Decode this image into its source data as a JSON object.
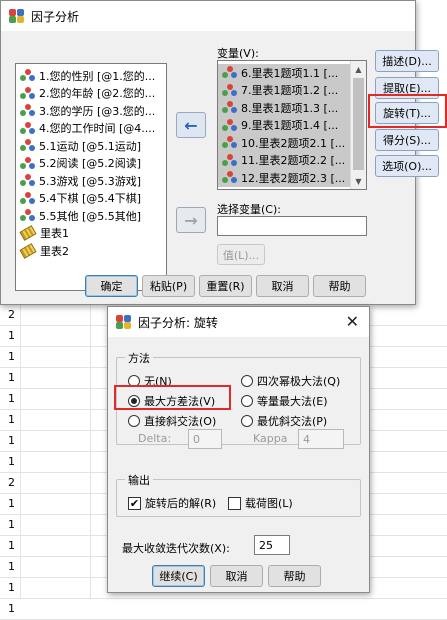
{
  "background_sheet": {
    "row_values": [
      "2",
      "1",
      "1",
      "1",
      "1",
      "1",
      "1",
      "1",
      "2",
      "1",
      "1",
      "1",
      "1",
      "1",
      "1"
    ]
  },
  "main_dialog": {
    "title": "因子分析",
    "source_variables": [
      {
        "label": "1.您的性别 [@1.您的...",
        "icon": "nominal-variable-icon"
      },
      {
        "label": "2.您的年龄 [@2.您的...",
        "icon": "nominal-variable-icon"
      },
      {
        "label": "3.您的学历 [@3.您的...",
        "icon": "nominal-variable-icon"
      },
      {
        "label": "4.您的工作时间 [@4....",
        "icon": "nominal-variable-icon"
      },
      {
        "label": "5.1运动 [@5.1运动]",
        "icon": "nominal-variable-icon"
      },
      {
        "label": "5.2阅读 [@5.2阅读]",
        "icon": "nominal-variable-icon"
      },
      {
        "label": "5.3游戏 [@5.3游戏]",
        "icon": "nominal-variable-icon"
      },
      {
        "label": "5.4下棋 [@5.4下棋]",
        "icon": "nominal-variable-icon"
      },
      {
        "label": "5.5其他 [@5.5其他]",
        "icon": "nominal-variable-icon"
      },
      {
        "label": "里表1",
        "icon": "scale-ruler-icon"
      },
      {
        "label": "里表2",
        "icon": "scale-ruler-icon"
      }
    ],
    "variables_label": "变量(V):",
    "selected_variables": [
      "6.里表1题项1.1 [...",
      "7.里表1题项1.2 [...",
      "8.里表1题项1.3 [...",
      "9.里表1题项1.4 [...",
      "10.里表2题项2.1 [...",
      "11.里表2题项2.2 [...",
      "12.里表2题项2.3 [..."
    ],
    "selection_variable_label": "选择变量(C):",
    "selection_variable_value": "",
    "value_button": "值(L)...",
    "side_buttons": [
      "描述(D)...",
      "提取(E)...",
      "旋转(T)...",
      "得分(S)...",
      "选项(O)..."
    ],
    "bottom_buttons": [
      "确定",
      "粘贴(P)",
      "重置(R)",
      "取消",
      "帮助"
    ],
    "highlighted_button": "旋转(T)..."
  },
  "rotation_dialog": {
    "title": "因子分析: 旋转",
    "method_group_label": "方法",
    "methods": [
      {
        "label": "无(N)",
        "selected": false
      },
      {
        "label": "四次幂极大法(Q)",
        "selected": false
      },
      {
        "label": "最大方差法(V)",
        "selected": true
      },
      {
        "label": "等量最大法(E)",
        "selected": false
      },
      {
        "label": "直接斜交法(O)",
        "selected": false
      },
      {
        "label": "最优斜交法(P)",
        "selected": false
      }
    ],
    "delta_label": "Delta:",
    "delta_value": "0",
    "kappa_label": "Kappa",
    "kappa_value": "4",
    "output_group_label": "输出",
    "rotated_solution_label": "旋转后的解(R)",
    "rotated_solution_checked": true,
    "loading_plot_label": "载荷图(L)",
    "loading_plot_checked": false,
    "max_iterations_label": "最大收敛迭代次数(X):",
    "max_iterations_value": "25",
    "buttons": [
      "继续(C)",
      "取消",
      "帮助"
    ],
    "highlight_color": "#e02a2a"
  }
}
